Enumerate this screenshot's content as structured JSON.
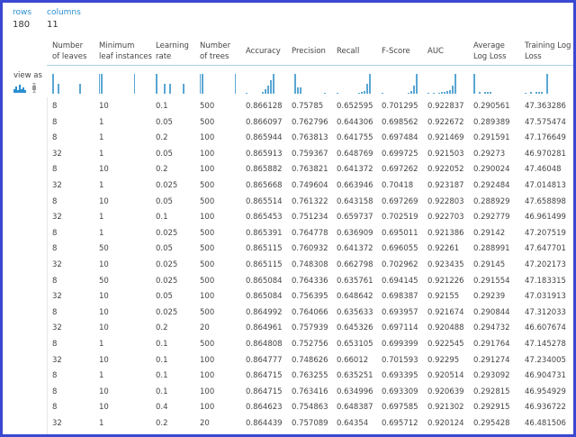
{
  "summary": {
    "rows_label": "rows",
    "rows_value": "180",
    "columns_label": "columns",
    "columns_value": "11"
  },
  "view_as": {
    "label": "view as",
    "options": [
      "histogram-icon",
      "boxplot-icon"
    ]
  },
  "accent_color": "#2a8fd0",
  "columns": [
    {
      "label": "Number\nof leaves",
      "hist": [
        1,
        0,
        0.5,
        0,
        0,
        0,
        0,
        0,
        0,
        0,
        0.5
      ]
    },
    {
      "label": "Minimum\nleaf instances",
      "hist": [
        1,
        1,
        0,
        0,
        0,
        0,
        0,
        0,
        0,
        0,
        0,
        0,
        0,
        0,
        0,
        0,
        1
      ]
    },
    {
      "label": "Learning\nrate",
      "hist": [
        1,
        0,
        0,
        0.5,
        0,
        0.5,
        0,
        0,
        0,
        0,
        0.5
      ]
    },
    {
      "label": "Number\nof trees",
      "hist": [
        1,
        1,
        0,
        0,
        0,
        0,
        0,
        0,
        0,
        0,
        0,
        0,
        0,
        0,
        0,
        0,
        0,
        1
      ]
    },
    {
      "label": "Accuracy",
      "hist": [
        0.05,
        0,
        0,
        0,
        0,
        0,
        0.1,
        0.25,
        0.4,
        0.7,
        1
      ]
    },
    {
      "label": "Precision",
      "hist": [
        0,
        1,
        0.3,
        0.3,
        0,
        0,
        0,
        0,
        0,
        0,
        0,
        0,
        0.05
      ]
    },
    {
      "label": "Recall",
      "hist": [
        0.05,
        0,
        0,
        0,
        0,
        0,
        0,
        0,
        0.05,
        0.1,
        0.15,
        0.5,
        1
      ]
    },
    {
      "label": "F-Score",
      "hist": [
        0.05,
        0,
        0,
        0,
        0,
        0,
        0,
        0,
        0,
        0,
        0.05,
        0.15,
        0.4,
        1
      ]
    },
    {
      "label": "AUC",
      "hist": [
        0.05,
        0,
        0.05,
        0,
        0.05,
        0.08,
        0.1,
        0.15,
        0.2,
        0.4,
        1
      ]
    },
    {
      "label": "Average\nLog Loss",
      "hist": [
        1,
        0,
        0.08,
        0,
        0.08,
        0.08,
        0.08
      ]
    },
    {
      "label": "Training Log\nLoss",
      "hist": [
        0.05,
        0,
        0.08,
        0,
        0.08,
        0.08,
        0.08,
        0,
        1
      ]
    }
  ],
  "rows": [
    [
      "8",
      "10",
      "0.1",
      "500",
      "0.866128",
      "0.75785",
      "0.652595",
      "0.701295",
      "0.922837",
      "0.290561",
      "47.363286"
    ],
    [
      "8",
      "1",
      "0.05",
      "500",
      "0.866097",
      "0.762796",
      "0.644306",
      "0.698562",
      "0.922672",
      "0.289389",
      "47.575474"
    ],
    [
      "8",
      "1",
      "0.2",
      "100",
      "0.865944",
      "0.763813",
      "0.641755",
      "0.697484",
      "0.921469",
      "0.291591",
      "47.176649"
    ],
    [
      "32",
      "1",
      "0.05",
      "100",
      "0.865913",
      "0.759367",
      "0.648769",
      "0.699725",
      "0.921503",
      "0.29273",
      "46.970281"
    ],
    [
      "8",
      "10",
      "0.2",
      "100",
      "0.865882",
      "0.763821",
      "0.641372",
      "0.697262",
      "0.922052",
      "0.290024",
      "47.46048"
    ],
    [
      "32",
      "1",
      "0.025",
      "500",
      "0.865668",
      "0.749604",
      "0.663946",
      "0.70418",
      "0.923187",
      "0.292484",
      "47.014813"
    ],
    [
      "8",
      "10",
      "0.05",
      "500",
      "0.865514",
      "0.761322",
      "0.643158",
      "0.697269",
      "0.922803",
      "0.288929",
      "47.658898"
    ],
    [
      "32",
      "1",
      "0.1",
      "100",
      "0.865453",
      "0.751234",
      "0.659737",
      "0.702519",
      "0.922703",
      "0.292779",
      "46.961499"
    ],
    [
      "8",
      "1",
      "0.025",
      "500",
      "0.865391",
      "0.764778",
      "0.636909",
      "0.695011",
      "0.921386",
      "0.29142",
      "47.207519"
    ],
    [
      "8",
      "50",
      "0.05",
      "500",
      "0.865115",
      "0.760932",
      "0.641372",
      "0.696055",
      "0.92261",
      "0.288991",
      "47.647701"
    ],
    [
      "32",
      "10",
      "0.025",
      "500",
      "0.865115",
      "0.748308",
      "0.662798",
      "0.702962",
      "0.923435",
      "0.29145",
      "47.202173"
    ],
    [
      "8",
      "50",
      "0.025",
      "500",
      "0.865084",
      "0.764336",
      "0.635761",
      "0.694145",
      "0.921226",
      "0.291554",
      "47.183315"
    ],
    [
      "32",
      "10",
      "0.05",
      "100",
      "0.865084",
      "0.756395",
      "0.648642",
      "0.698387",
      "0.92155",
      "0.29239",
      "47.031913"
    ],
    [
      "8",
      "10",
      "0.025",
      "500",
      "0.864992",
      "0.764066",
      "0.635633",
      "0.693957",
      "0.921674",
      "0.290844",
      "47.312033"
    ],
    [
      "32",
      "10",
      "0.2",
      "20",
      "0.864961",
      "0.757939",
      "0.645326",
      "0.697114",
      "0.920488",
      "0.294732",
      "46.607674"
    ],
    [
      "8",
      "1",
      "0.1",
      "500",
      "0.864808",
      "0.752756",
      "0.653105",
      "0.699399",
      "0.922545",
      "0.291764",
      "47.145278"
    ],
    [
      "32",
      "10",
      "0.1",
      "100",
      "0.864777",
      "0.748626",
      "0.66012",
      "0.701593",
      "0.92295",
      "0.291274",
      "47.234005"
    ],
    [
      "8",
      "1",
      "0.1",
      "100",
      "0.864715",
      "0.763255",
      "0.635251",
      "0.693395",
      "0.920514",
      "0.293092",
      "46.904731"
    ],
    [
      "8",
      "10",
      "0.1",
      "100",
      "0.864715",
      "0.763416",
      "0.634996",
      "0.693309",
      "0.920639",
      "0.292815",
      "46.954929"
    ],
    [
      "8",
      "10",
      "0.4",
      "100",
      "0.864623",
      "0.754863",
      "0.648387",
      "0.697585",
      "0.921302",
      "0.292915",
      "46.936722"
    ],
    [
      "32",
      "1",
      "0.2",
      "20",
      "0.864439",
      "0.757089",
      "0.64354",
      "0.695712",
      "0.920124",
      "0.295428",
      "46.481506"
    ]
  ]
}
